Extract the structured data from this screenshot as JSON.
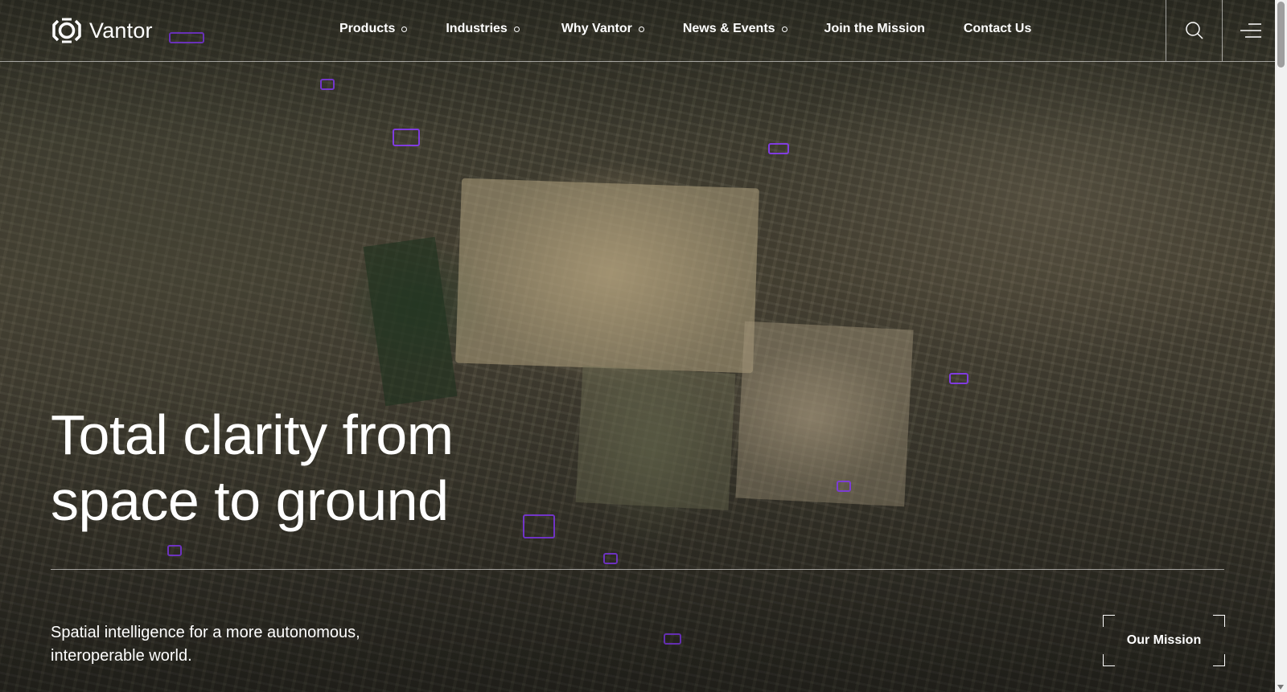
{
  "brand": {
    "name": "Vantor",
    "accent": "#8c3cff"
  },
  "header": {
    "nav": [
      {
        "label": "Products",
        "has_dropdown": true
      },
      {
        "label": "Industries",
        "has_dropdown": true
      },
      {
        "label": "Why Vantor",
        "has_dropdown": true
      },
      {
        "label": "News & Events",
        "has_dropdown": true
      },
      {
        "label": "Join the Mission",
        "has_dropdown": false
      },
      {
        "label": "Contact Us",
        "has_dropdown": false
      }
    ],
    "icons": [
      "search-icon",
      "menu-icon"
    ]
  },
  "hero": {
    "title_line1": "Total clarity from",
    "title_line2": "space to ground",
    "subtitle": "Spatial intelligence for a more autonomous, interoperable world.",
    "cta_label": "Our Mission",
    "background": "satellite imagery"
  }
}
